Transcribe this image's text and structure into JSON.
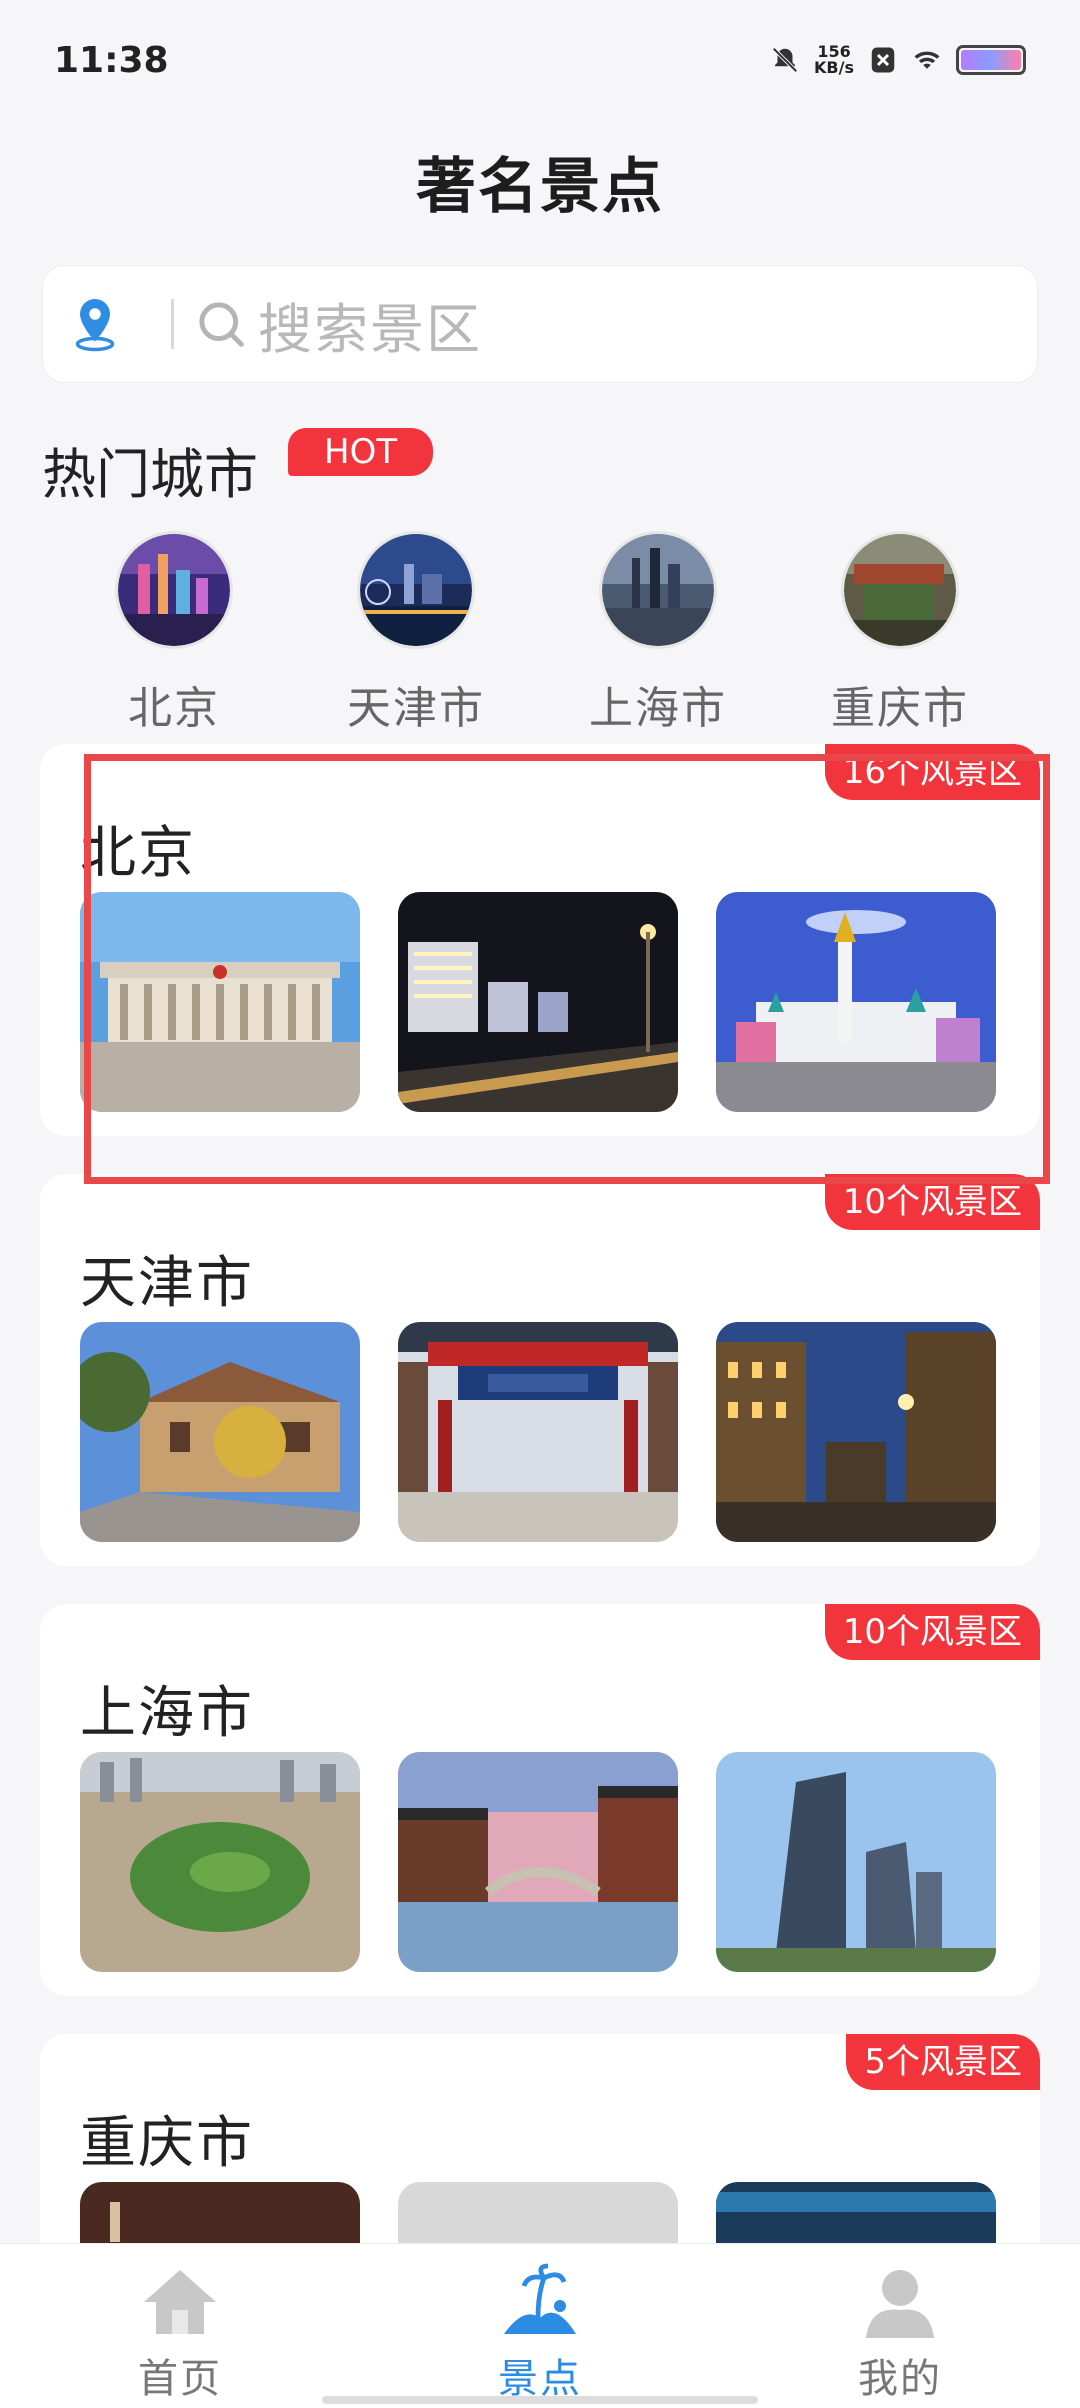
{
  "status": {
    "time": "11:38",
    "speed_value": "156",
    "speed_unit": "KB/s"
  },
  "header": {
    "title": "著名景点"
  },
  "search": {
    "placeholder": "搜索景区"
  },
  "hot": {
    "title": "热门城市",
    "badge": "HOT",
    "cities": [
      {
        "name": "北京"
      },
      {
        "name": "天津市"
      },
      {
        "name": "上海市"
      },
      {
        "name": "重庆市"
      }
    ]
  },
  "cards": [
    {
      "title": "北京",
      "badge": "16个风景区"
    },
    {
      "title": "天津市",
      "badge": "10个风景区"
    },
    {
      "title": "上海市",
      "badge": "10个风景区"
    },
    {
      "title": "重庆市",
      "badge": "5个风景区"
    }
  ],
  "nav": {
    "items": [
      {
        "label": "首页",
        "icon": "home-icon"
      },
      {
        "label": "景点",
        "icon": "scenery-icon"
      },
      {
        "label": "我的",
        "icon": "profile-icon"
      }
    ],
    "active": "景点",
    "accent": "#2c8be3"
  },
  "colors": {
    "badge": "#f2343d",
    "highlight": "#e9474a"
  }
}
